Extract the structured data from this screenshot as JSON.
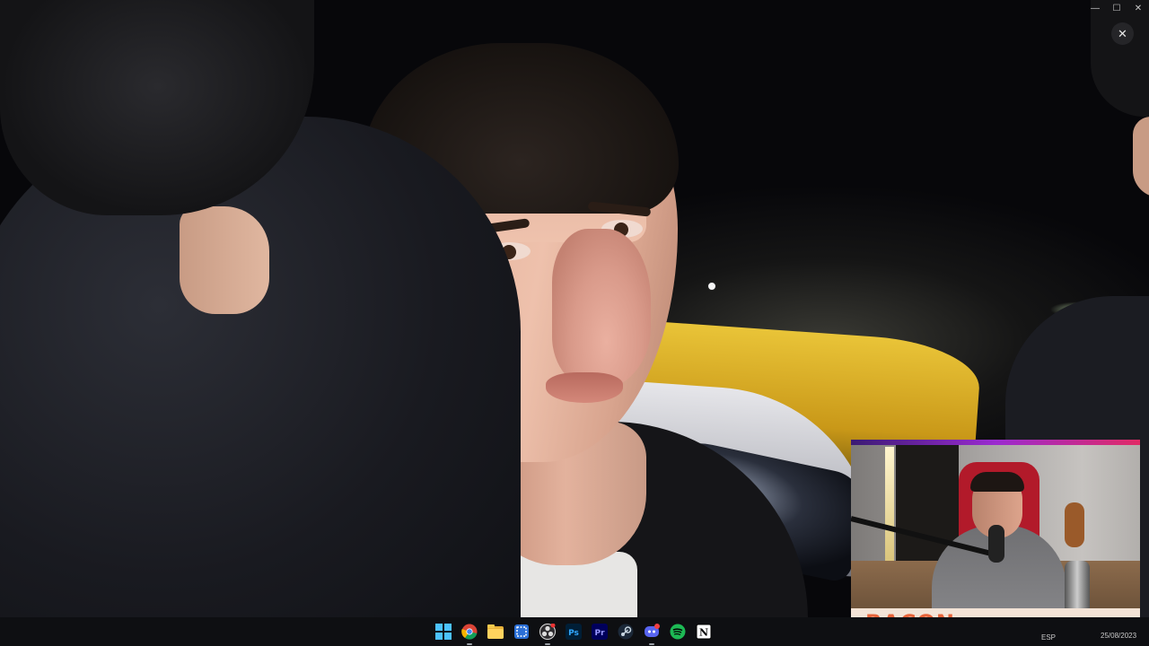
{
  "window": {
    "minimize_glyph": "—",
    "maximize_glyph": "☐",
    "close_glyph": "✕",
    "overlay_close_glyph": "✕"
  },
  "stream": {
    "webcam_label": "BACON",
    "label_color": "#e8643a",
    "bar_gradient": [
      "#3b1b74",
      "#9b2bd0",
      "#e12b66"
    ]
  },
  "taskbar": {
    "icons": [
      {
        "name": "windows-start-icon",
        "running": false
      },
      {
        "name": "chrome-icon",
        "running": true
      },
      {
        "name": "file-explorer-icon",
        "running": false
      },
      {
        "name": "snipping-tool-icon",
        "running": false
      },
      {
        "name": "obs-icon",
        "running": true
      },
      {
        "name": "photoshop-icon",
        "running": false,
        "label": "Ps"
      },
      {
        "name": "premiere-icon",
        "running": false,
        "label": "Pr"
      },
      {
        "name": "steam-icon",
        "running": false
      },
      {
        "name": "discord-icon",
        "running": true
      },
      {
        "name": "spotify-icon",
        "running": false
      },
      {
        "name": "notion-icon",
        "running": false,
        "label": "N"
      }
    ],
    "tray_language": "ESP",
    "tray_date": "25/08/2023"
  }
}
